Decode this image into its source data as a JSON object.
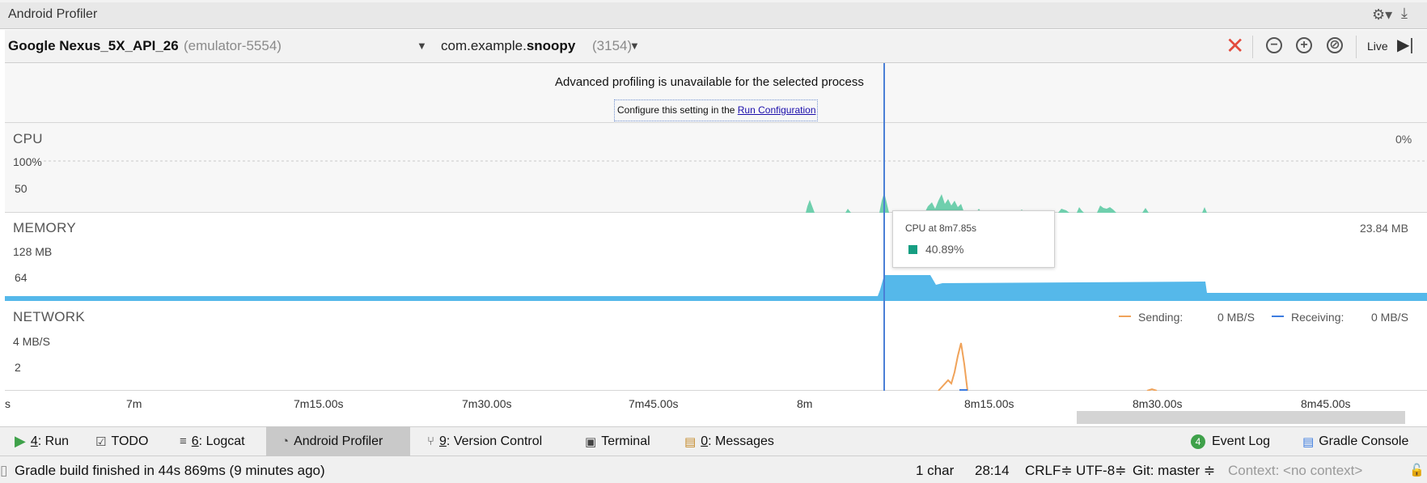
{
  "window": {
    "title": "Android Profiler"
  },
  "toolbar": {
    "device_name": "Google Nexus_5X_API_26",
    "device_serial": "(emulator-5554)",
    "process_prefix": "com.example.",
    "process_bold": "snoopy",
    "process_pid": "(3154)",
    "live_label": "Live",
    "icons": [
      "stop-icon",
      "zoom-out-icon",
      "zoom-in-icon",
      "reset-zoom-icon",
      "live-icon"
    ]
  },
  "notice": {
    "text": "Advanced profiling is unavailable for the selected process",
    "configure_prefix": "Configure this setting in the",
    "configure_link": "Run Configuration"
  },
  "cpu": {
    "title": "CPU",
    "value": "0%",
    "axis_top": "100%",
    "axis_mid": "50"
  },
  "memory": {
    "title": "MEMORY",
    "value": "23.84 MB",
    "axis_top": "128 MB",
    "axis_mid": "64"
  },
  "network": {
    "title": "NETWORK",
    "axis_top": "4 MB/S",
    "axis_mid": "2",
    "sending_label": "Sending:",
    "sending_value": "0 MB/S",
    "receiving_label": "Receiving:",
    "receiving_value": "0 MB/S"
  },
  "tooltip": {
    "title": "CPU at 8m7.85s",
    "value": "40.89%"
  },
  "time_axis": {
    "ticks": [
      "s",
      "7m",
      "7m15.00s",
      "7m30.00s",
      "7m45.00s",
      "8m",
      "8m15.00s",
      "8m30.00s",
      "8m45.00s"
    ]
  },
  "colors": {
    "cpu_fill": "#6fcfad",
    "memory_fill": "#55b8ea",
    "sending": "#f0a35a",
    "receiving": "#3d7ce0",
    "marker": "#4a7fd6",
    "stop": "#e34b3d"
  },
  "tool_windows": {
    "run_num": "4",
    "run_label": ": Run",
    "todo": "TODO",
    "logcat_num": "6",
    "logcat_label": ": Logcat",
    "profiler": "Android Profiler",
    "vcs_num": "9",
    "vcs_label": ": Version Control",
    "terminal": "Terminal",
    "messages_num": "0",
    "messages_label": ": Messages",
    "event_log_count": "4",
    "event_log": "Event Log",
    "gradle_console": "Gradle Console"
  },
  "status": {
    "message": "Gradle build finished in 44s 869ms (9 minutes ago)",
    "selection": "1 char",
    "caret": "28:14",
    "line_sep": "CRLF≑",
    "encoding": "UTF-8≑",
    "git": "Git: master ≑",
    "context": "Context: <no context>"
  }
}
